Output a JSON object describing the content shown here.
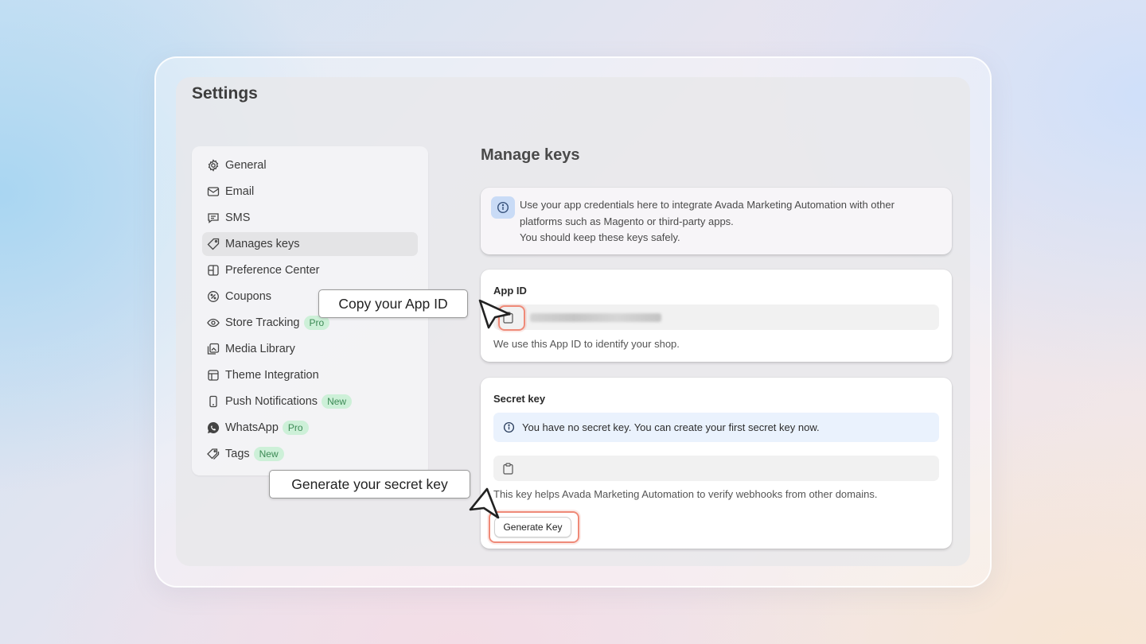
{
  "page": {
    "title": "Settings"
  },
  "sidebar": {
    "items": [
      {
        "label": "General",
        "icon": "gear-icon"
      },
      {
        "label": "Email",
        "icon": "email-icon"
      },
      {
        "label": "SMS",
        "icon": "chat-bubble-icon"
      },
      {
        "label": "Manages keys",
        "icon": "tag-icon",
        "active": true
      },
      {
        "label": "Preference Center",
        "icon": "preference-icon"
      },
      {
        "label": "Coupons",
        "icon": "discount-icon"
      },
      {
        "label": "Store Tracking",
        "icon": "eye-icon",
        "badge": "Pro"
      },
      {
        "label": "Media Library",
        "icon": "images-icon"
      },
      {
        "label": "Theme Integration",
        "icon": "layout-icon"
      },
      {
        "label": "Push Notifications",
        "icon": "mobile-icon",
        "badge": "New"
      },
      {
        "label": "WhatsApp",
        "icon": "whatsapp-icon",
        "badge": "Pro"
      },
      {
        "label": "Tags",
        "icon": "tags-icon",
        "badge": "New"
      }
    ]
  },
  "main": {
    "title": "Manage keys",
    "info": {
      "line1": "Use your app credentials here to integrate Avada Marketing Automation with other",
      "line2": "platforms such as Magento or third-party apps.",
      "line3": "You should keep these keys safely."
    },
    "app_id": {
      "label": "App ID",
      "help": "We use this App ID to identify your shop."
    },
    "secret_key": {
      "label": "Secret key",
      "notice": "You have no secret key. You can create your first secret key now.",
      "help": "This key helps Avada Marketing Automation to verify webhooks from other domains.",
      "button": "Generate Key"
    }
  },
  "callouts": {
    "copy_app_id": "Copy your App ID",
    "generate_secret": "Generate your secret key"
  },
  "colors": {
    "highlight": "#ef8a78",
    "badge_bg": "#cdf0d8",
    "badge_text": "#3c8a55",
    "notice_bg": "#eaf2fd"
  }
}
